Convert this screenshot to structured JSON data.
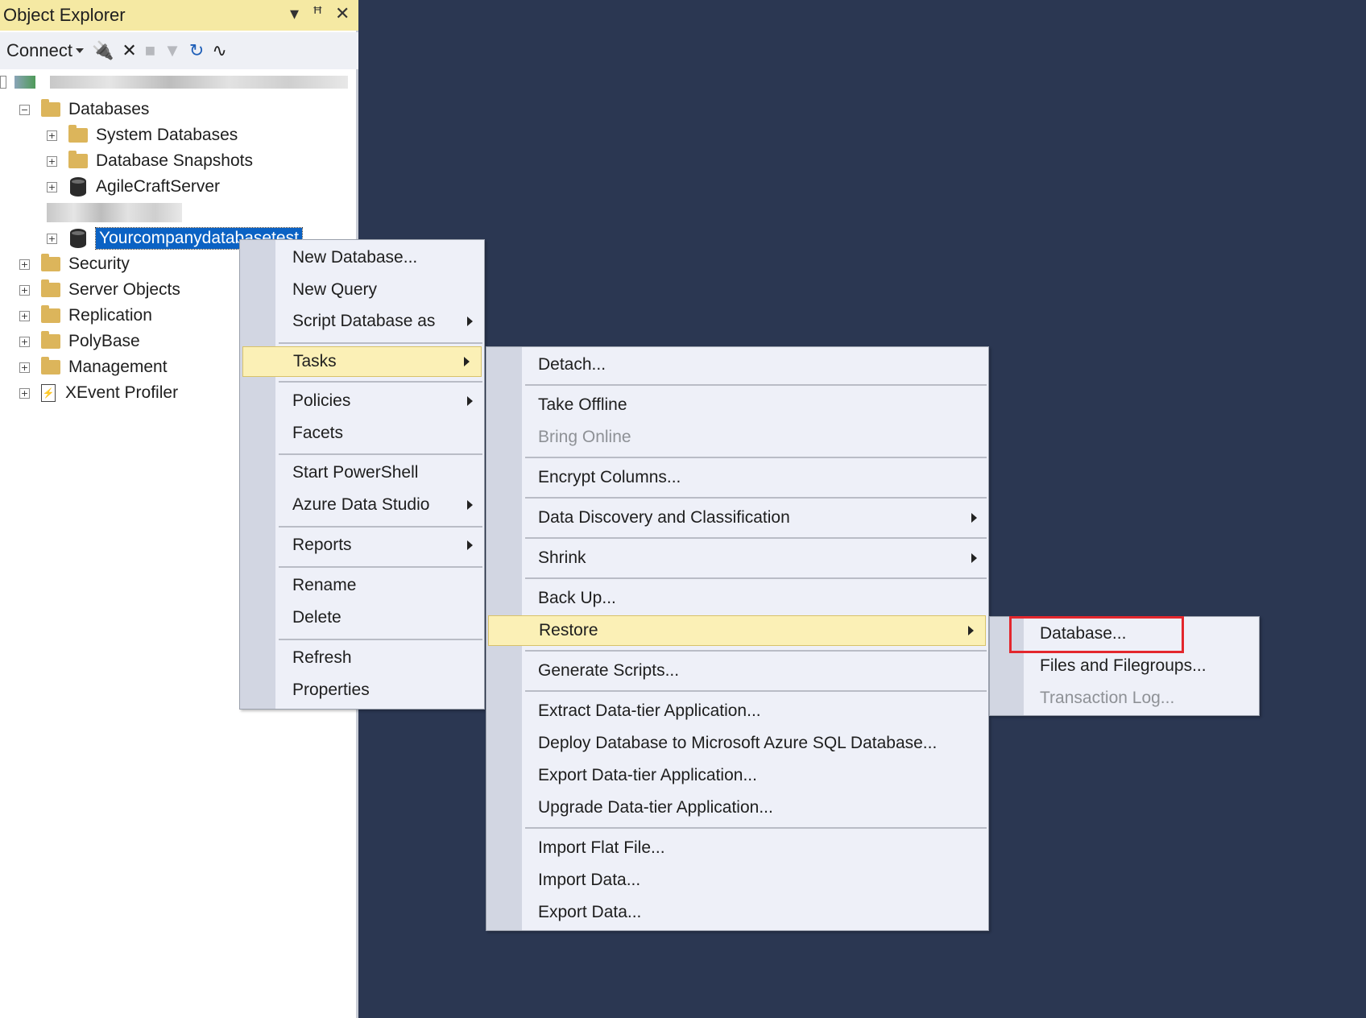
{
  "panel": {
    "title": "Object Explorer"
  },
  "toolbar": {
    "connect_label": "Connect"
  },
  "tree": {
    "databases": "Databases",
    "system_databases": "System Databases",
    "database_snapshots": "Database Snapshots",
    "agilecraft": "AgileCraftServer",
    "selected_db": "Yourcompanydatabasetest",
    "security": "Security",
    "server_objects": "Server Objects",
    "replication": "Replication",
    "polybase": "PolyBase",
    "management": "Management",
    "xevent": "XEvent Profiler"
  },
  "context_menu": {
    "new_database": "New Database...",
    "new_query": "New Query",
    "script_database_as": "Script Database as",
    "tasks": "Tasks",
    "policies": "Policies",
    "facets": "Facets",
    "start_powershell": "Start PowerShell",
    "azure_data_studio": "Azure Data Studio",
    "reports": "Reports",
    "rename": "Rename",
    "delete": "Delete",
    "refresh": "Refresh",
    "properties": "Properties"
  },
  "tasks_menu": {
    "detach": "Detach...",
    "take_offline": "Take Offline",
    "bring_online": "Bring Online",
    "encrypt_columns": "Encrypt Columns...",
    "data_discovery": "Data Discovery and Classification",
    "shrink": "Shrink",
    "back_up": "Back Up...",
    "restore": "Restore",
    "generate_scripts": "Generate Scripts...",
    "extract_dac": "Extract Data-tier Application...",
    "deploy_azure": "Deploy Database to Microsoft Azure SQL Database...",
    "export_dac": "Export Data-tier Application...",
    "upgrade_dac": "Upgrade Data-tier Application...",
    "import_flat": "Import Flat File...",
    "import_data": "Import Data...",
    "export_data": "Export Data..."
  },
  "restore_menu": {
    "database": "Database...",
    "files_filegroups": "Files and Filegroups...",
    "transaction_log": "Transaction Log..."
  },
  "colors": {
    "desktop": "#2b3752",
    "title_bar": "#f5e9a3",
    "menu_highlight": "#fbf0b6",
    "selection": "#0b62c4",
    "callout": "#e3272d"
  }
}
